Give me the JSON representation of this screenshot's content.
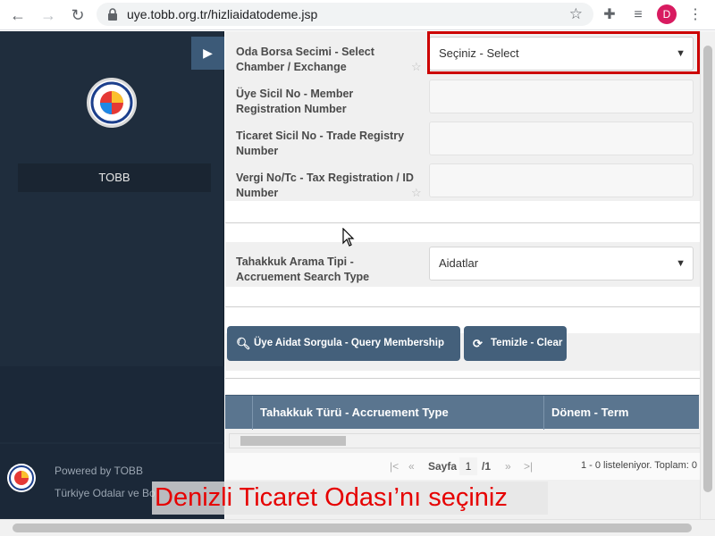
{
  "browser": {
    "url": "uye.tobb.org.tr/hizliaidatodeme.jsp",
    "profile_initial": "D"
  },
  "sidebar": {
    "org_name": "TOBB",
    "powered_by": "Powered by TOBB",
    "union_name": "Türkiye Odalar ve Bo"
  },
  "form": {
    "chamber_label": "Oda Borsa Secimi - Select Chamber / Exchange",
    "chamber_value": "Seçiniz - Select",
    "member_reg_label": "Üye Sicil No - Member Registration Number",
    "trade_reg_label": "Ticaret Sicil No - Trade Registry Number",
    "tax_reg_label": "Vergi No/Tc - Tax Registration / ID Number",
    "search_type_label": "Tahakkuk Arama Tipi - Accruement Search Type",
    "search_type_value": "Aidatlar"
  },
  "buttons": {
    "query": "Üye Aidat Sorgula - Query Membership Dues",
    "clear": "Temizle - Clear"
  },
  "grid": {
    "columns": [
      "Tahakkuk Türü - Accruement Type",
      "Dönem - Term"
    ]
  },
  "pager": {
    "page_label": "Sayfa",
    "page_value": "1",
    "page_total": "/1",
    "summary": "1 - 0 listeleniyor. Toplam: 0"
  },
  "caption": "Denizli Ticaret Odası’nı seçiniz",
  "colors": {
    "sidebar_bg": "#1f2d3d",
    "button_bg": "#44607b",
    "highlight": "#cc0000",
    "caption_text": "#e60000"
  }
}
